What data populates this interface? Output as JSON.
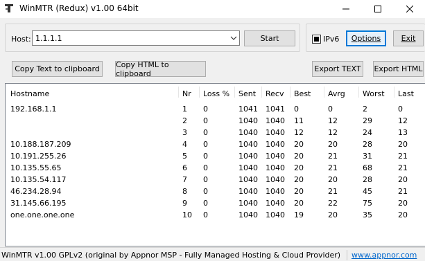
{
  "window": {
    "title": "WinMTR (Redux) v1.00 64bit",
    "controls": {
      "minimize": "minimize-icon",
      "maximize": "maximize-icon",
      "close": "close-icon"
    }
  },
  "host": {
    "label": "Host:",
    "value": "1.1.1.1"
  },
  "toolbar": {
    "start_label": "Start",
    "ipv6_label": "IPv6",
    "ipv6_checked": true,
    "options_label": "Options",
    "exit_label": "Exit",
    "copy_text_label": "Copy Text to clipboard",
    "copy_html_label": "Copy HTML to clipboard",
    "export_text_label": "Export TEXT",
    "export_html_label": "Export HTML"
  },
  "table": {
    "columns": [
      "Hostname",
      "Nr",
      "Loss %",
      "Sent",
      "Recv",
      "Best",
      "Avrg",
      "Worst",
      "Last"
    ],
    "rows": [
      [
        "192.168.1.1",
        "1",
        "0",
        "1041",
        "1041",
        "0",
        "0",
        "2",
        "0"
      ],
      [
        "",
        "2",
        "0",
        "1040",
        "1040",
        "11",
        "12",
        "29",
        "12"
      ],
      [
        "",
        "3",
        "0",
        "1040",
        "1040",
        "12",
        "12",
        "24",
        "13"
      ],
      [
        "10.188.187.209",
        "4",
        "0",
        "1040",
        "1040",
        "20",
        "20",
        "28",
        "20"
      ],
      [
        "10.191.255.26",
        "5",
        "0",
        "1040",
        "1040",
        "20",
        "21",
        "31",
        "21"
      ],
      [
        "10.135.55.65",
        "6",
        "0",
        "1040",
        "1040",
        "20",
        "21",
        "68",
        "21"
      ],
      [
        "10.135.54.117",
        "7",
        "0",
        "1040",
        "1040",
        "20",
        "20",
        "28",
        "20"
      ],
      [
        "46.234.28.94",
        "8",
        "0",
        "1040",
        "1040",
        "20",
        "21",
        "45",
        "21"
      ],
      [
        "31.145.66.195",
        "9",
        "0",
        "1040",
        "1040",
        "20",
        "22",
        "75",
        "20"
      ],
      [
        "one.one.one.one",
        "10",
        "0",
        "1040",
        "1040",
        "19",
        "20",
        "35",
        "20"
      ]
    ]
  },
  "statusbar": {
    "text": "WinMTR v1.00 GPLv2 (original by Appnor MSP - Fully Managed Hosting & Cloud Provider)",
    "link": "www.appnor.com"
  },
  "colors": {
    "window_bg": "#f0f0f0",
    "accent": "#0078d7",
    "link": "#0066cc"
  }
}
